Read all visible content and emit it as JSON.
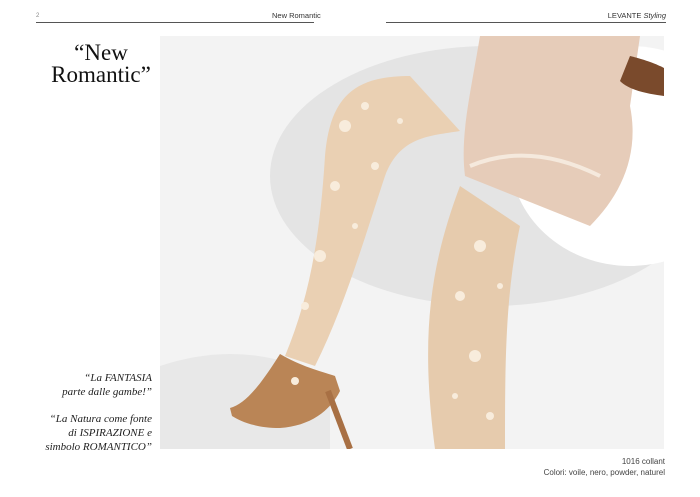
{
  "header": {
    "page_number": "2",
    "section": "New Romantic",
    "brand": "LEVANTE",
    "brand_suffix": "Styling"
  },
  "title": {
    "line1": "“New",
    "line2": "Romantic”"
  },
  "quotes": [
    "“La FANTASIA\nparte dalle gambe!”",
    "“La Natura come fonte\ndi ISPIRAZIONE e\nsimbolo ROMANTICO”"
  ],
  "caption": {
    "product": "1016 collant",
    "colors": "Colori: voile, nero, powder, naturel"
  },
  "photo": {
    "background_color": "#f2f2f2",
    "tights_color": "#e9cfb2",
    "lace_color": "#f7ead9",
    "dress_color": "#e7cdb9",
    "shoe_color": "#b98354"
  }
}
